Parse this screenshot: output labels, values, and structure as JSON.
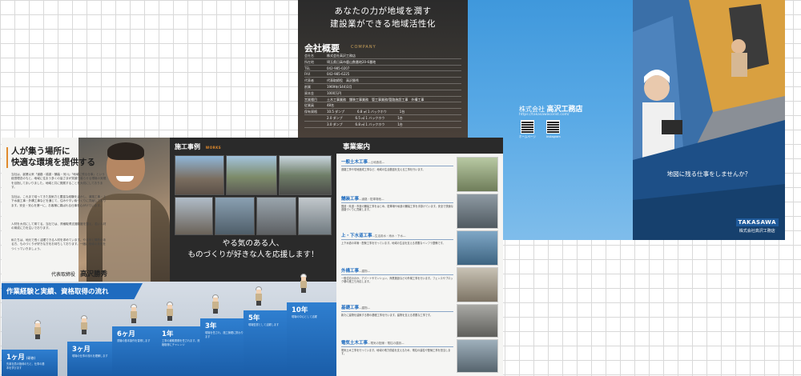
{
  "back_spread": {
    "catch_lines": [
      "あなたの力が地域を潤す",
      "建設業ができる地域活性化"
    ],
    "company_overview_title": "会社概要",
    "company_overview_title_en": "COMPANY",
    "company_rows": [
      {
        "k": "会社名",
        "v": "株式会社高沢工務店"
      },
      {
        "k": "所在地",
        "v": "埼玉県日高市鹿山数番地20-6番地"
      },
      {
        "k": "TEL",
        "v": "042-985-0207"
      },
      {
        "k": "FAX",
        "v": "042-985-6225"
      },
      {
        "k": "代表者",
        "v": "代表取締役　高沢勝秀"
      },
      {
        "k": "創業",
        "v": "1969年(S44)3月"
      },
      {
        "k": "資本金",
        "v": "1000万円"
      },
      {
        "k": "営業種目",
        "v": "土木工事業務　舗装工事業務　管工事業務/管路施設工事　外構工事"
      },
      {
        "k": "従業員",
        "v": "48名"
      },
      {
        "k": "保有資格",
        "v": "10.5 ダンプ　　　　6.8 ㎥ 1 バックホウ　　　　1台"
      },
      {
        "k": "",
        "v": "2.0 ダンプ　　　　6.5 ㎥ 1 バックホウ　　　　1台"
      },
      {
        "k": "",
        "v": "3.0 ダンプ　　　　6.8 ㎥ 1 バックホウ　　　　1台"
      }
    ],
    "company_name_prefix": "株式会社",
    "company_name": "高沢工務店",
    "company_url": "https://takasawacorist.com/",
    "qr_labels": [
      "ホームページ",
      "Instagram"
    ]
  },
  "front_cover": {
    "tagline": "地図に残る仕事をしませんか？",
    "logo_en": "TAKASAWA",
    "logo_jp": "株式会社高沢工務店"
  },
  "president_page": {
    "heading_lines": [
      "人が集う場所に",
      "快適な環境を提供する"
    ],
    "paragraphs": [
      "当社は、創業以来「道路・橋梁・舗装・河川」「地域に残る仕事」という経営理念のもと、地域に住まう多くの皆さまが笑顔で暮らせる環境の実現を目指してまいりました。地域と共に発展することを大切にしております。",
      "当社は、これまで培ってきた技術力と豊富な経験を活かし、道路工事・上下水道工事・外構工事などを通じて、住みやすい街づくりに貢献しております。安全・安心を第一に、お客様に喜ばれる仕事を心がけています。",
      "人材を大切にして育てる。当社では、資格取得支援制度を整え、若い人材の育成に力を注いでおります。",
      "私たちは、地元で長く活躍できる人材を求めています。やる気と情熱のある方、ものづくりが好きな方をお待ちしております。一緒に地域の未来をつくっていきましょう。"
    ],
    "sign_title": "代表取締役",
    "sign_name": "高沢勝秀"
  },
  "career_flow": {
    "title": "作業経験と実績、資格取得の流れ",
    "steps": [
      {
        "period": "1ヶ月",
        "note": "(研修)",
        "desc": "先輩社員の指導のもと、仕事の基本を学びます"
      },
      {
        "period": "3ヶ月",
        "note": "",
        "desc": "現場の仕事の流れを理解します"
      },
      {
        "period": "6ヶ月",
        "note": "",
        "desc": "重機の基本操作を習得します"
      },
      {
        "period": "1年",
        "note": "",
        "desc": "工事の補助業務を任されます。資格取得にチャレンジ"
      },
      {
        "period": "3年",
        "note": "",
        "desc": "現場を任され、施工管理に携わります"
      },
      {
        "period": "5年",
        "note": "",
        "desc": "現場監督として活躍します"
      },
      {
        "period": "10年",
        "note": "",
        "desc": "現場の中心として活躍"
      }
    ]
  },
  "works_page": {
    "title": "施工事例",
    "title_en": "WORKS",
    "catch_lines": [
      "やる気のある人、",
      "ものづくりが好きな人を応援します！"
    ]
  },
  "business_page": {
    "title": "事業案内",
    "items": [
      {
        "name": "一般土木工事",
        "sub": "―土地造成―",
        "desc": "道路工事や宅地造成工事など、地域の生活基盤を支える工事を行います。"
      },
      {
        "name": "舗装工事",
        "sub": "―道路・駐車場他―",
        "desc": "国道・県道・市道の舗装工事をはじめ、駐車場や私道の舗装工事を手掛けています。安全で快適な道路づくりに貢献します。"
      },
      {
        "name": "上・下水道工事",
        "sub": "―生活用水・雨水・下水―",
        "desc": "上下水道の本管・配管工事を行っています。地域の生活を支える重要なインフラ整備です。"
      },
      {
        "name": "外構工事",
        "sub": "―建物―",
        "desc": "一般住宅のほか、アパートやマンション、商業施設などの外構工事を行います。フェンスやブロック塀の施工も対応します。"
      },
      {
        "name": "基礎工事",
        "sub": "―建物―",
        "desc": "新たに建物を建築する際の基礎工事を行います。建物を支える重要な工事です。"
      },
      {
        "name": "電気土木工事",
        "sub": "―電気の配線・電柱の建設―",
        "desc": "電気土木工事を行っています。地域の電力供給を支えるため、電柱の建柱や配線工事を担当します。"
      }
    ]
  },
  "colors": {
    "accent_blue": "#1e6bbf",
    "accent_orange": "#e08a2c",
    "dark": "#2a2a2a"
  }
}
